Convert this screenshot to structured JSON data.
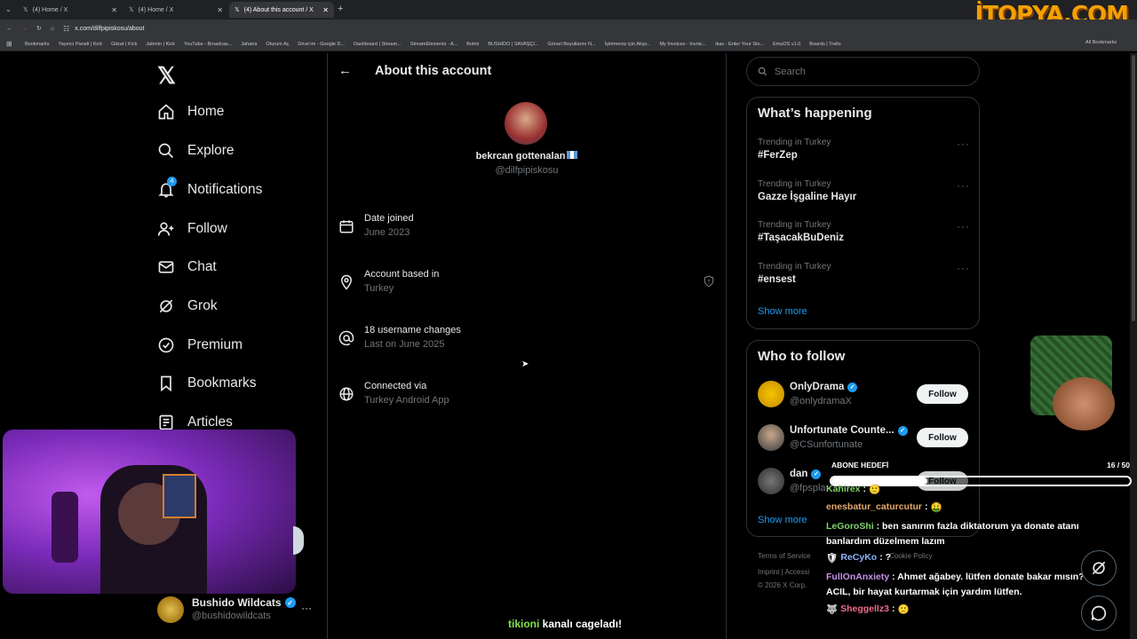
{
  "browser": {
    "tabs": [
      {
        "label": "(4) Home / X"
      },
      {
        "label": "(4) Home / X"
      },
      {
        "label": "(4) About this account / X"
      }
    ],
    "new_tab": "+",
    "url": "x.com/dilfpipiskosu/about",
    "bookmarks": [
      "Bookmarks",
      "Yayıncı Paneli | Kick",
      "Gitzat | Kick",
      "Jahmin | Kick",
      "YouTube - Broadcas...",
      "Jaharia",
      "Oturum Aç",
      "Drive'ım - Google D...",
      "Dashboard | Stream...",
      "StreamElements - A...",
      "Botrix",
      "BUSHIDO | SAVAŞÇI...",
      "Görsel Boyutlarını N...",
      "İşletmeniz için Alışv...",
      "My Invoices - Invoic...",
      "ikas - Enter Your Sto...",
      "EmuOS v1.0",
      "Boards | Trello"
    ],
    "all_bookmarks": "All Bookmarks",
    "overlay_logo": "İTOPYA.COM"
  },
  "sidebar": {
    "items": [
      {
        "label": "Home",
        "icon": "home-icon"
      },
      {
        "label": "Explore",
        "icon": "search-icon"
      },
      {
        "label": "Notifications",
        "icon": "bell-icon",
        "badge": "4"
      },
      {
        "label": "Follow",
        "icon": "follow-icon"
      },
      {
        "label": "Chat",
        "icon": "mail-icon"
      },
      {
        "label": "Grok",
        "icon": "grok-icon"
      },
      {
        "label": "Premium",
        "icon": "premium-icon"
      },
      {
        "label": "Bookmarks",
        "icon": "bookmark-icon"
      },
      {
        "label": "Articles",
        "icon": "article-icon"
      }
    ],
    "account": {
      "name": "Bushido Wildcats",
      "handle": "@bushidowildcats",
      "more": "···"
    }
  },
  "main": {
    "title": "About this account",
    "profile": {
      "name": "bekrcan gottenalan",
      "handle": "@dilfpipiskosu"
    },
    "rows": [
      {
        "title": "Date joined",
        "sub": "June 2023",
        "icon": "calendar-icon"
      },
      {
        "title": "Account based in",
        "sub": "Turkey",
        "icon": "location-icon"
      },
      {
        "title": "18 username changes",
        "sub": "Last on June 2025",
        "icon": "at-icon"
      },
      {
        "title": "Connected via",
        "sub": "Turkey Android App",
        "icon": "globe-icon"
      }
    ]
  },
  "right": {
    "search_placeholder": "Search",
    "happening": {
      "title": "What’s happening",
      "trends": [
        {
          "context": "Trending in Turkey",
          "name": "#FerZep"
        },
        {
          "context": "Trending in Turkey",
          "name": "Gazze İşgaline Hayır"
        },
        {
          "context": "Trending in Turkey",
          "name": "#TaşacakBuDeniz"
        },
        {
          "context": "Trending in Turkey",
          "name": "#ensest"
        }
      ],
      "show_more": "Show more"
    },
    "who_to_follow": {
      "title": "Who to follow",
      "people": [
        {
          "name": "OnlyDrama",
          "handle": "@onlydramaX",
          "button": "Follow"
        },
        {
          "name": "Unfortunate Counte...",
          "handle": "@CSunfortunate",
          "button": "Follow"
        },
        {
          "name": "dan",
          "handle": "@fpspla",
          "button": "Follow"
        }
      ],
      "show_more": "Show more"
    },
    "footer": {
      "line1": "Terms of Service",
      "line2": "Imprint  |  Accessi",
      "cookie": "Cookie Policy",
      "copyright": "© 2026 X Corp."
    }
  },
  "overlay": {
    "goal_label": "ABONE HEDEFİ",
    "goal_count": "16 / 50",
    "goal_progress": 0.32,
    "chat": [
      {
        "user": "Kahirex",
        "text": ":",
        "color": "#7fd36b"
      },
      {
        "user": "enesbatur_caturcutur",
        "text": ":",
        "color": "#e8a96b"
      },
      {
        "user": "LeGoroShi",
        "text": ": ben sanırım fazla diktatorum ya donate atanı banlardım düzelmem lazım",
        "color": "#7fd36b"
      },
      {
        "user": "ReCyKo",
        "text": ": ?",
        "color": "#8ab4f8"
      },
      {
        "user": "FullOnAnxiety",
        "text": ": Ahmet ağabey. lütfen donate bakar mısın? ACIL, bir hayat kurtarmak için yardım lütfen.",
        "color": "#c792ea"
      },
      {
        "user": "Sheggellz3",
        "text": ":",
        "color": "#f06b8b"
      }
    ],
    "bottom_banner": {
      "highlight": "tikioni",
      "rest": " kanalı cageladı!"
    }
  },
  "colors": {
    "accent": "#1d9bf0",
    "verified": "#1d9bf0",
    "text_secondary": "#71767b",
    "border": "#2f3336"
  }
}
